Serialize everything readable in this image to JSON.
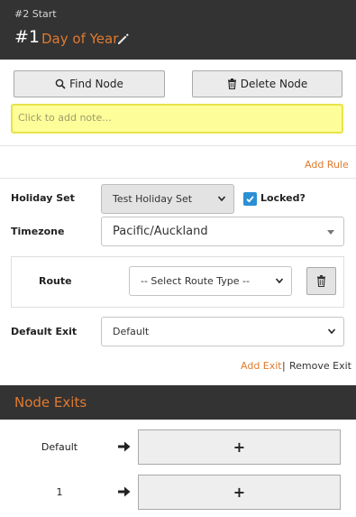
{
  "header": {
    "breadcrumb": "#2 Start",
    "node_number": "#1",
    "node_title": "Day of Year"
  },
  "toolbar": {
    "find_label": "Find Node",
    "delete_label": "Delete Node"
  },
  "note": {
    "placeholder": "Click to add note..."
  },
  "rules": {
    "add_rule": "Add Rule"
  },
  "form": {
    "holiday_set_label": "Holiday Set",
    "holiday_set_value": "Test Holiday Set",
    "locked_label": "Locked?",
    "locked_checked": true,
    "timezone_label": "Timezone",
    "timezone_value": "Pacific/Auckland",
    "route_label": "Route",
    "route_value": "-- Select Route Type --",
    "default_exit_label": "Default Exit",
    "default_exit_value": "Default"
  },
  "exit_links": {
    "add": "Add Exit",
    "separator": "|",
    "remove": "Remove Exit"
  },
  "node_exits": {
    "title": "Node Exits",
    "items": [
      {
        "label": "Default",
        "add": "+"
      },
      {
        "label": "1",
        "add": "+"
      }
    ]
  },
  "colors": {
    "accent": "#e07a2f",
    "header_bg": "#333333",
    "note_bg": "#fdfd9a",
    "checkbox": "#2a8fd4"
  },
  "icons": [
    "pencil-icon",
    "search-icon",
    "trash-icon",
    "chevron-down-icon",
    "check-icon",
    "arrow-right-icon",
    "plus-icon"
  ]
}
